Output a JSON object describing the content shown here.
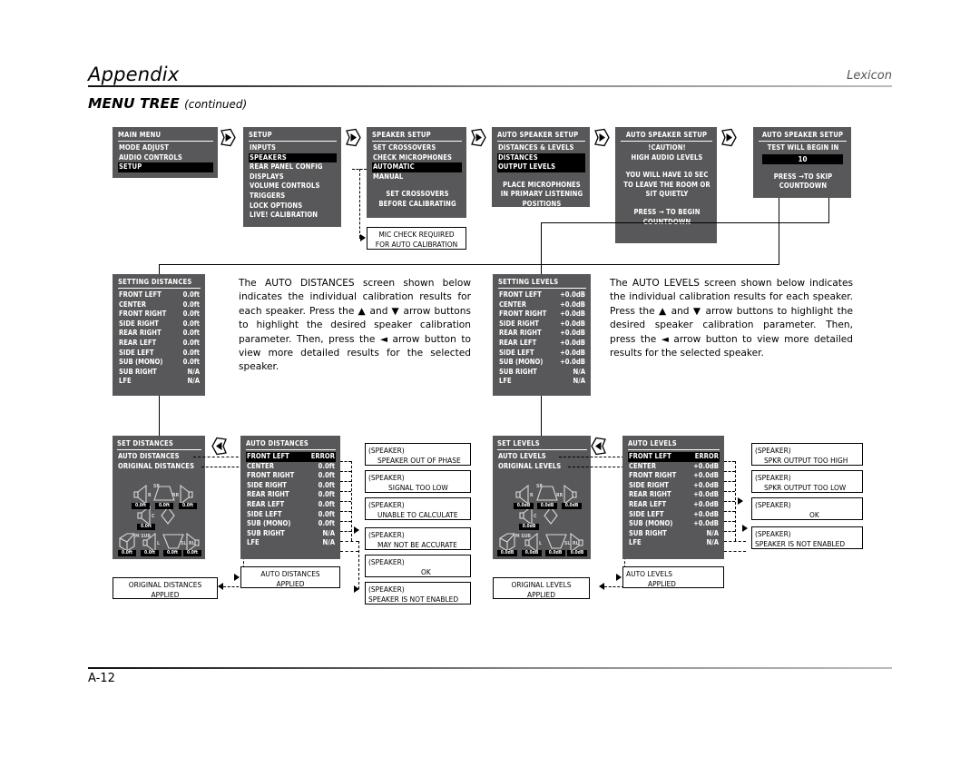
{
  "header": {
    "appendix": "Appendix",
    "brand": "Lexicon",
    "section_title": "MENU TREE",
    "section_continued": "(continued)"
  },
  "footer": {
    "page_number": "A-12"
  },
  "screens": {
    "main_menu": {
      "title": "MAIN MENU",
      "items": [
        {
          "label": "MODE ADJUST",
          "selected": false
        },
        {
          "label": "AUDIO CONTROLS",
          "selected": false
        },
        {
          "label": "SETUP",
          "selected": true
        }
      ]
    },
    "setup": {
      "title": "SETUP",
      "items": [
        {
          "label": "INPUTS",
          "selected": false
        },
        {
          "label": "SPEAKERS",
          "selected": true
        },
        {
          "label": "REAR PANEL CONFIG",
          "selected": false
        },
        {
          "label": "DISPLAYS",
          "selected": false
        },
        {
          "label": "VOLUME CONTROLS",
          "selected": false
        },
        {
          "label": "TRIGGERS",
          "selected": false
        },
        {
          "label": "LOCK OPTIONS",
          "selected": false
        },
        {
          "label": "LIVE! CALIBRATION",
          "selected": false
        }
      ]
    },
    "speaker_setup": {
      "title": "SPEAKER SETUP",
      "items": [
        {
          "label": "SET CROSSOVERS",
          "selected": false
        },
        {
          "label": "CHECK MICROPHONES",
          "selected": false
        },
        {
          "label": "AUTOMATIC",
          "selected": true
        },
        {
          "label": "MANUAL",
          "selected": false
        }
      ],
      "notice": [
        "SET CROSSOVERS",
        "BEFORE CALIBRATING"
      ]
    },
    "mic_check_note": {
      "lines": [
        "MIC CHECK REQUIRED",
        "FOR AUTO CALIBRATION"
      ]
    },
    "auto_speaker_setup_1": {
      "title": "AUTO SPEAKER SETUP",
      "items": [
        {
          "label": "DISTANCES & LEVELS",
          "selected": false
        },
        {
          "label": "DISTANCES",
          "selected": true
        },
        {
          "label": "OUTPUT LEVELS",
          "selected": true
        }
      ],
      "notice": [
        "PLACE MICROPHONES",
        "IN PRIMARY LISTENING",
        "POSITIONS"
      ]
    },
    "auto_speaker_setup_caution": {
      "title": "AUTO SPEAKER SETUP",
      "lines": [
        "!CAUTION!",
        "HIGH AUDIO LEVELS",
        "",
        "YOU WILL HAVE 10 SEC",
        "TO LEAVE THE ROOM OR",
        "SIT QUIETLY",
        "",
        "PRESS → TO BEGIN",
        "COUNTDOWN"
      ]
    },
    "auto_speaker_setup_countdown": {
      "title": "AUTO SPEAKER SETUP",
      "prompt": "TEST WILL BEGIN IN",
      "counter": "10",
      "lines": [
        "PRESS →TO SKIP",
        "COUNTDOWN"
      ]
    },
    "setting_distances": {
      "title": "SETTING DISTANCES",
      "rows": [
        {
          "name": "FRONT LEFT",
          "value": "0.0ft"
        },
        {
          "name": "CENTER",
          "value": "0.0ft"
        },
        {
          "name": "FRONT RIGHT",
          "value": "0.0ft"
        },
        {
          "name": "SIDE RIGHT",
          "value": "0.0ft"
        },
        {
          "name": "REAR RIGHT",
          "value": "0.0ft"
        },
        {
          "name": "REAR LEFT",
          "value": "0.0ft"
        },
        {
          "name": "SIDE LEFT",
          "value": "0.0ft"
        },
        {
          "name": "SUB (MONO)",
          "value": "0.0ft"
        },
        {
          "name": "SUB RIGHT",
          "value": "N/A"
        },
        {
          "name": "LFE",
          "value": "N/A"
        }
      ]
    },
    "setting_levels": {
      "title": "SETTING LEVELS",
      "rows": [
        {
          "name": "FRONT LEFT",
          "value": "+0.0dB"
        },
        {
          "name": "CENTER",
          "value": "+0.0dB"
        },
        {
          "name": "FRONT RIGHT",
          "value": "+0.0dB"
        },
        {
          "name": "SIDE RIGHT",
          "value": "+0.0dB"
        },
        {
          "name": "REAR RIGHT",
          "value": "+0.0dB"
        },
        {
          "name": "REAR LEFT",
          "value": "+0.0dB"
        },
        {
          "name": "SIDE LEFT",
          "value": "+0.0dB"
        },
        {
          "name": "SUB (MONO)",
          "value": "+0.0dB"
        },
        {
          "name": "SUB RIGHT",
          "value": "N/A"
        },
        {
          "name": "LFE",
          "value": "N/A"
        }
      ]
    },
    "set_distances": {
      "title": "SET DISTANCES",
      "items": [
        {
          "label": "AUTO DISTANCES",
          "selected": false
        },
        {
          "label": "ORIGINAL DISTANCES",
          "selected": false
        }
      ],
      "diagram": [
        {
          "pos": "front-left",
          "label": "R",
          "value": "0.0ft"
        },
        {
          "pos": "screen",
          "label": "SR",
          "value": "0.0ft"
        },
        {
          "pos": "rear-right",
          "label": "RR",
          "value": "0.0ft"
        },
        {
          "pos": "center",
          "label": "C",
          "value": "0.0ft"
        },
        {
          "pos": "sub",
          "label": "M SUB",
          "value": "0.0ft"
        },
        {
          "pos": "left",
          "label": "L",
          "value": "0.0ft"
        },
        {
          "pos": "side-left",
          "label": "SL",
          "value": "0.0ft"
        },
        {
          "pos": "rear-left",
          "label": "RL",
          "value": "0.0ft"
        }
      ]
    },
    "set_levels": {
      "title": "SET LEVELS",
      "items": [
        {
          "label": "AUTO LEVELS",
          "selected": false
        },
        {
          "label": "ORIGINAL LEVELS",
          "selected": false
        }
      ],
      "diagram": [
        {
          "pos": "front-left",
          "label": "R",
          "value": "0.0dB"
        },
        {
          "pos": "screen",
          "label": "SR",
          "value": "0.0dB"
        },
        {
          "pos": "rear-right",
          "label": "RR",
          "value": "0.0dB"
        },
        {
          "pos": "center",
          "label": "C",
          "value": "0.0dB"
        },
        {
          "pos": "sub",
          "label": "M SUB",
          "value": "0.0dB"
        },
        {
          "pos": "left",
          "label": "L",
          "value": "0.0dB"
        },
        {
          "pos": "side-left",
          "label": "SL",
          "value": "0.0dB"
        },
        {
          "pos": "rear-left",
          "label": "RL",
          "value": "0.0dB"
        }
      ]
    },
    "auto_distances": {
      "title": "AUTO DISTANCES",
      "rows": [
        {
          "name": "FRONT LEFT",
          "value": "ERROR",
          "selected": true
        },
        {
          "name": "CENTER",
          "value": "0.0ft",
          "selected": false
        },
        {
          "name": "FRONT RIGHT",
          "value": "0.0ft",
          "selected": false
        },
        {
          "name": "SIDE RIGHT",
          "value": "0.0ft",
          "selected": false
        },
        {
          "name": "REAR RIGHT",
          "value": "0.0ft",
          "selected": false
        },
        {
          "name": "REAR LEFT",
          "value": "0.0ft",
          "selected": false
        },
        {
          "name": "SIDE LEFT",
          "value": "0.0ft",
          "selected": false
        },
        {
          "name": "SUB (MONO)",
          "value": "0.0ft",
          "selected": false
        },
        {
          "name": "SUB RIGHT",
          "value": "N/A",
          "selected": false
        },
        {
          "name": "LFE",
          "value": "N/A",
          "selected": false
        }
      ]
    },
    "auto_levels": {
      "title": "AUTO LEVELS",
      "rows": [
        {
          "name": "FRONT LEFT",
          "value": "ERROR",
          "selected": true
        },
        {
          "name": "CENTER",
          "value": "+0.0dB",
          "selected": false
        },
        {
          "name": "FRONT RIGHT",
          "value": "+0.0dB",
          "selected": false
        },
        {
          "name": "SIDE RIGHT",
          "value": "+0.0dB",
          "selected": false
        },
        {
          "name": "REAR RIGHT",
          "value": "+0.0dB",
          "selected": false
        },
        {
          "name": "REAR LEFT",
          "value": "+0.0dB",
          "selected": false
        },
        {
          "name": "SIDE LEFT",
          "value": "+0.0dB",
          "selected": false
        },
        {
          "name": "SUB (MONO)",
          "value": "+0.0dB",
          "selected": false
        },
        {
          "name": "SUB RIGHT",
          "value": "N/A",
          "selected": false
        },
        {
          "name": "LFE",
          "value": "N/A",
          "selected": false
        }
      ]
    }
  },
  "notes": {
    "auto_distances_applied": [
      "AUTO DISTANCES",
      "APPLIED"
    ],
    "original_distances_applied": [
      "ORIGINAL DISTANCES",
      "APPLIED"
    ],
    "auto_levels_applied": [
      "AUTO LEVELS",
      "APPLIED"
    ],
    "original_levels_applied": [
      "ORIGINAL LEVELS",
      "APPLIED"
    ]
  },
  "distance_messages": [
    {
      "line1": "(SPEAKER)",
      "line2": "SPEAKER OUT OF PHASE"
    },
    {
      "line1": "(SPEAKER)",
      "line2": "SIGNAL TOO LOW"
    },
    {
      "line1": "(SPEAKER)",
      "line2": "UNABLE TO CALCULATE"
    },
    {
      "line1": "(SPEAKER)",
      "line2": "MAY NOT BE ACCURATE"
    },
    {
      "line1": "(SPEAKER)",
      "line2": "OK"
    },
    {
      "line1": "(SPEAKER)",
      "line2": "SPEAKER IS NOT ENABLED"
    }
  ],
  "level_messages": [
    {
      "line1": "(SPEAKER)",
      "line2": "SPKR OUTPUT TOO HIGH"
    },
    {
      "line1": "(SPEAKER)",
      "line2": "SPKR OUTPUT TOO LOW"
    },
    {
      "line1": "(SPEAKER)",
      "line2": "OK"
    },
    {
      "line1": "(SPEAKER)",
      "line2": "SPEAKER IS NOT ENABLED"
    }
  ],
  "paragraphs": {
    "distances": "The AUTO DISTANCES screen shown below indicates the individual calibration results for each speaker. Press the ▲ and ▼ arrow buttons to highlight the desired speaker calibration parameter. Then, press the ◄ arrow button to view more detailed results for the selected speaker.",
    "levels": "The AUTO LEVELS screen shown below indicates the individual calibration results for each speaker. Press the ▲ and ▼ arrow buttons to highlight the desired speaker calibration parameter. Then, press the ◄ arrow button to view more detailed results for the selected speaker."
  },
  "colors": {
    "osd_background": "#58585a",
    "osd_highlight": "#000000",
    "osd_text": "#ffffff",
    "page_background": "#ffffff"
  }
}
